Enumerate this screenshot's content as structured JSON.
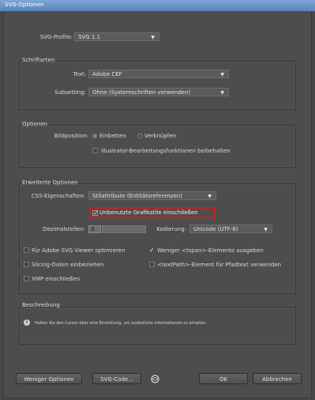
{
  "window": {
    "title": "SVG-Optionen"
  },
  "svg_profile": {
    "label": "SVG-Profile:",
    "value": "SVG 1.1"
  },
  "fonts": {
    "group_title": "Schriftarten",
    "text_label": "Text:",
    "text_value": "Adobe CEF",
    "subsetting_label": "Subsetting:",
    "subsetting_value": "Ohne (Systemschriften verwenden)"
  },
  "options": {
    "group_title": "Optionen",
    "image_location_label": "Bildposition:",
    "embed_label": "Einbetten",
    "link_label": "Verknüpfen",
    "embed_selected": true,
    "preserve_label": "Illustrator-Bearbeitungsfunktionen beibehalten",
    "preserve_checked": false
  },
  "advanced": {
    "group_title": "Erweiterte Optionen",
    "css_label": "CSS-Eigenschaften:",
    "css_value": "Stilattribute (Entitätsreferenzen)",
    "unused_styles_label": "Unbenutzte Grafikstile einschließen",
    "unused_styles_checked": true,
    "decimal_label": "Dezimalstellen:",
    "decimal_value": "3",
    "encoding_label": "Kodierung:",
    "encoding_value": "Unicode (UTF-8)",
    "adobe_viewer_label": "Für Adobe SVG Viewer optimieren",
    "adobe_viewer_checked": false,
    "fewer_tspan_label": "Weniger <tspan>-Elemente ausgeben",
    "fewer_tspan_checked": true,
    "slicing_label": "Slicing-Daten einbeziehen",
    "slicing_checked": false,
    "textpath_label": "<textPath>-Element für Pfadtext verwenden",
    "textpath_checked": false,
    "xmp_label": "XMP einschließen",
    "xmp_checked": false
  },
  "description": {
    "group_title": "Beschreibung",
    "text": "Halten Sie den Cursor über eine Einstellung, um zusätzliche Informationen zu erhalten."
  },
  "buttons": {
    "fewer_options": "Weniger Optionen",
    "svg_code": "SVG-Code...",
    "ok": "OK",
    "cancel": "Abbrechen"
  },
  "icons": {
    "dropdown_arrow": "▼",
    "check": "✓",
    "info": "i",
    "globe": "globe-icon"
  },
  "colors": {
    "highlight": "#d01e1e"
  }
}
